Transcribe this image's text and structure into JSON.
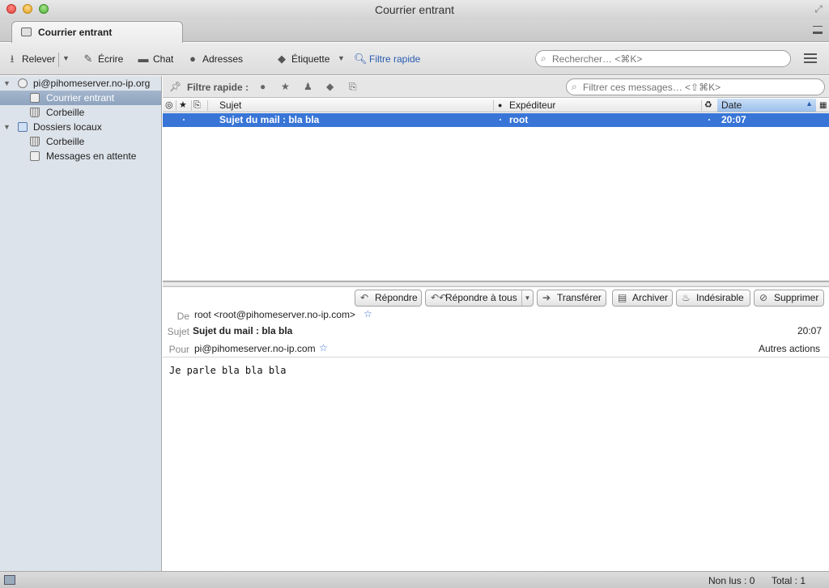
{
  "window": {
    "title": "Courrier entrant"
  },
  "tab": {
    "label": "Courrier entrant"
  },
  "toolbar": {
    "get_mail": "Relever",
    "write": "Écrire",
    "chat": "Chat",
    "address_book": "Adresses",
    "tag": "Étiquette",
    "quick_filter": "Filtre rapide",
    "search_placeholder": "Rechercher… <⌘K>"
  },
  "folders": {
    "account": "pi@pihomeserver.no-ip.org",
    "inbox": "Courrier entrant",
    "trash": "Corbeille",
    "local": "Dossiers locaux",
    "local_trash": "Corbeille",
    "outbox": "Messages en attente"
  },
  "quick_filter_bar": {
    "label": "Filtre rapide :",
    "filter_placeholder": "Filtrer ces messages… <⇧⌘K>"
  },
  "thread_columns": {
    "subject": "Sujet",
    "sender": "Expéditeur",
    "date": "Date"
  },
  "messages": [
    {
      "subject": "Sujet du mail : bla bla",
      "sender": "root",
      "date": "20:07"
    }
  ],
  "header_buttons": {
    "reply": "Répondre",
    "reply_all": "Répondre à tous",
    "forward": "Transférer",
    "archive": "Archiver",
    "junk": "Indésirable",
    "delete": "Supprimer"
  },
  "message": {
    "from_label": "De",
    "from": "root <root@pihomeserver.no-ip.com>",
    "subject_label": "Sujet",
    "subject": "Sujet du mail : bla bla",
    "time": "20:07",
    "to_label": "Pour",
    "to": "pi@pihomeserver.no-ip.com",
    "other_actions": "Autres actions",
    "body": "Je parle bla bla bla"
  },
  "status": {
    "unread": "Non lus : 0",
    "total": "Total : 1"
  },
  "colors": {
    "selection": "#3875d7",
    "folder_pane": "#dde3ea",
    "star": "#3a72d8"
  }
}
